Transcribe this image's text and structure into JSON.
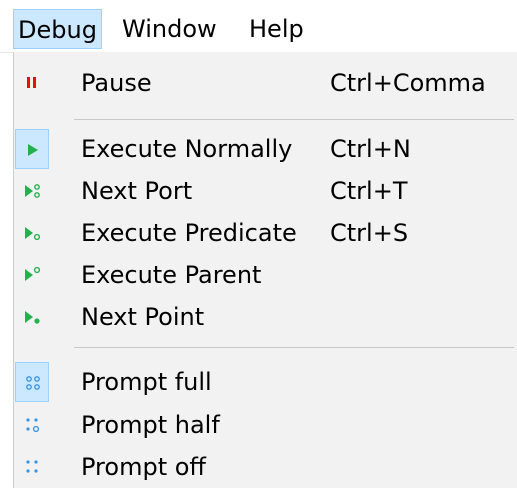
{
  "menubar": {
    "items": [
      {
        "label": "Debug",
        "active": true
      },
      {
        "label": "Window"
      },
      {
        "label": "Help"
      }
    ]
  },
  "menu": {
    "groups": [
      [
        {
          "label": "Pause",
          "shortcut": "Ctrl+Comma",
          "icon": "pause-icon"
        }
      ],
      [
        {
          "label": "Execute Normally",
          "shortcut": "Ctrl+N",
          "icon": "play-icon",
          "checked": true
        },
        {
          "label": "Next Port",
          "shortcut": "Ctrl+T",
          "icon": "next-port-icon"
        },
        {
          "label": "Execute Predicate",
          "shortcut": "Ctrl+S",
          "icon": "execute-predicate-icon"
        },
        {
          "label": "Execute Parent",
          "shortcut": "",
          "icon": "execute-parent-icon"
        },
        {
          "label": "Next Point",
          "shortcut": "",
          "icon": "next-point-icon"
        }
      ],
      [
        {
          "label": "Prompt full",
          "shortcut": "",
          "icon": "prompt-full-icon",
          "checked": true
        },
        {
          "label": "Prompt half",
          "shortcut": "",
          "icon": "prompt-half-icon"
        },
        {
          "label": "Prompt off",
          "shortcut": "",
          "icon": "prompt-off-icon"
        }
      ]
    ]
  },
  "colors": {
    "accent_green": "#22b14c",
    "pause_red": "#e51400",
    "prompt_blue": "#3a96dd",
    "checked_background": "#cce8ff",
    "checked_border": "#99d1ff",
    "menu_background": "#f2f2f2"
  }
}
